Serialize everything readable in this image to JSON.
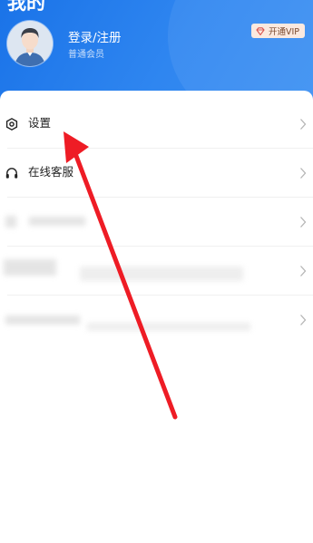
{
  "header": {
    "title": "我的",
    "avatar_icon": "default-avatar",
    "login_label": "登录/注册",
    "member_level": "普通会员",
    "vip_button_label": "开通VIP",
    "vip_icon": "gem-icon"
  },
  "menu": {
    "items": [
      {
        "label": "设置",
        "icon": "settings-icon"
      },
      {
        "label": "在线客服",
        "icon": "headset-icon"
      },
      {
        "label": "",
        "icon": "blurred-icon"
      },
      {
        "label": "",
        "icon": "blurred-icon"
      },
      {
        "label": "",
        "icon": "blurred-icon"
      }
    ]
  },
  "colors": {
    "header_blue": "#1a73e8",
    "vip_bg": "#fbe9df",
    "annotation_arrow": "#ee1c25"
  }
}
